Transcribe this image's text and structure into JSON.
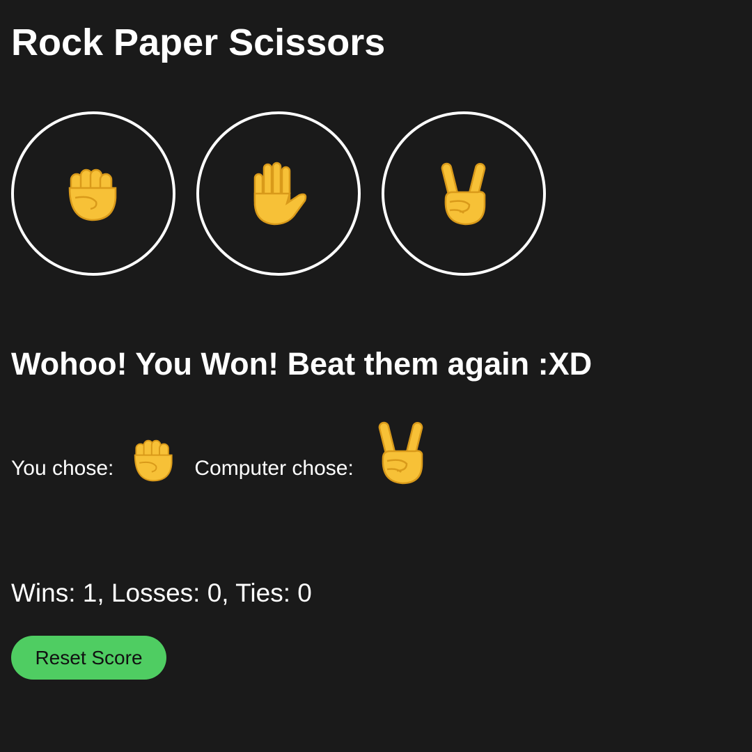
{
  "app": {
    "title": "Rock Paper Scissors"
  },
  "choices": [
    {
      "id": "rock",
      "icon": "raised-fist-icon"
    },
    {
      "id": "paper",
      "icon": "raised-hand-icon"
    },
    {
      "id": "scissors",
      "icon": "victory-hand-icon"
    }
  ],
  "result": {
    "message": "Wohoo! You Won! Beat them again :XD"
  },
  "moves": {
    "player_label": "You chose:",
    "player_choice": "rock",
    "computer_label": "Computer chose:",
    "computer_choice": "scissors"
  },
  "score": {
    "text": "Wins: 1, Losses: 0, Ties: 0",
    "wins": 1,
    "losses": 0,
    "ties": 0
  },
  "reset": {
    "label": "Reset Score"
  },
  "colors": {
    "background": "#1a1a1a",
    "text": "#ffffff",
    "button_border": "#ffffff",
    "reset_button": "#4fcd62",
    "emoji_skin": "#f7c137",
    "emoji_outline": "#d99a1a"
  }
}
